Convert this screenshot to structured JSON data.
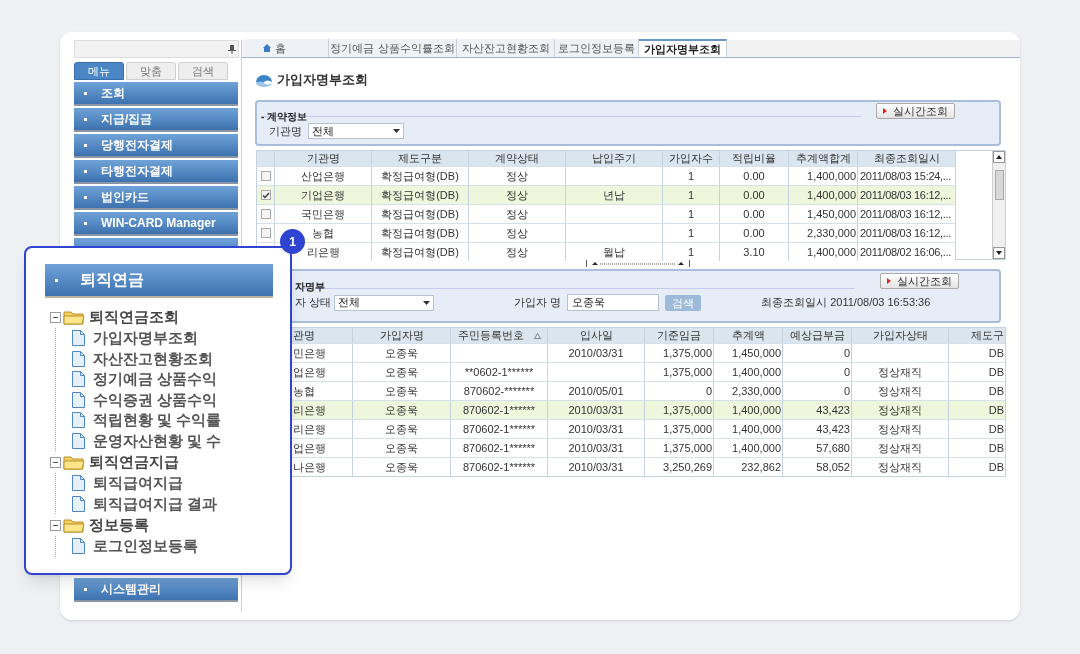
{
  "sidebar": {
    "tabs": [
      {
        "label": "메뉴",
        "selected": true
      },
      {
        "label": "맞춤",
        "selected": false
      },
      {
        "label": "검색",
        "selected": false
      }
    ],
    "items": [
      {
        "label": "조회"
      },
      {
        "label": "지급/집금"
      },
      {
        "label": "당행전자결제"
      },
      {
        "label": "타행전자결제"
      },
      {
        "label": "법인카드"
      },
      {
        "label": "WIN-CARD Manager"
      }
    ],
    "footer_item": {
      "label": "시스템관리"
    }
  },
  "tabs": [
    {
      "label": "홈",
      "kind": "home",
      "selected": false
    },
    {
      "label": "정기예금 상품수익률조회",
      "kind": "page",
      "selected": false
    },
    {
      "label": "자산잔고현황조회",
      "kind": "page",
      "selected": false
    },
    {
      "label": "로그인정보등록",
      "kind": "page",
      "selected": false
    },
    {
      "label": "가입자명부조회",
      "kind": "page",
      "selected": true
    }
  ],
  "page_title": "가입자명부조회",
  "contract_panel": {
    "title": "- 계약정보",
    "button": "실시간조회",
    "filter_label": "기관명",
    "filter_value": "전체"
  },
  "contract_table": {
    "columns": [
      "기관명",
      "제도구분",
      "계약상태",
      "납입주기",
      "가입자수",
      "적립비율",
      "추계액합계",
      "최종조회일시"
    ],
    "rows": [
      {
        "checked": false,
        "selected": false,
        "cells": [
          "산업은행",
          "확정급여형(DB)",
          "정상",
          "",
          "1",
          "0.00",
          "1,400,000",
          "2011/08/03 15:24,..."
        ]
      },
      {
        "checked": true,
        "selected": true,
        "cells": [
          "기업은행",
          "확정급여형(DB)",
          "정상",
          "년납",
          "1",
          "0.00",
          "1,400,000",
          "2011/08/03 16:12,..."
        ]
      },
      {
        "checked": false,
        "selected": false,
        "cells": [
          "국민은행",
          "확정급여형(DB)",
          "정상",
          "",
          "1",
          "0.00",
          "1,450,000",
          "2011/08/03 16:12,..."
        ]
      },
      {
        "checked": false,
        "selected": false,
        "cells": [
          "농협",
          "확정급여형(DB)",
          "정상",
          "",
          "1",
          "0.00",
          "2,330,000",
          "2011/08/03 16:12,..."
        ]
      },
      {
        "selected": false,
        "cells": [
          "리은행",
          "확정급여형(DB)",
          "정상",
          "월납",
          "1",
          "3.10",
          "1,400,000",
          "2011/08/02 16:06,..."
        ]
      }
    ]
  },
  "member_panel": {
    "title": "자명부",
    "button": "실시간조회",
    "status_label": "자 상태",
    "status_value": "전체",
    "name_label": "가입자 명",
    "name_value": "오종욱",
    "search_button": "검색",
    "last_query": "최종조회일시 2011/08/03 16:53:36"
  },
  "member_table": {
    "columns": [
      "관명",
      "가입자명",
      "주민등록번호",
      "입사일",
      "기준임금",
      "추계액",
      "예상급부금",
      "가입자상태",
      "제도구"
    ],
    "rows": [
      {
        "selected": false,
        "cells": [
          "민은행",
          "오종욱",
          "",
          "2010/03/31",
          "1,375,000",
          "1,450,000",
          "0",
          "",
          "DB"
        ]
      },
      {
        "selected": false,
        "cells": [
          "업은행",
          "오종욱",
          "**0602-1******",
          "",
          "1,375,000",
          "1,400,000",
          "0",
          "정상재직",
          "DB"
        ]
      },
      {
        "selected": false,
        "cells": [
          "농협",
          "오종욱",
          "870602-*******",
          "2010/05/01",
          "0",
          "2,330,000",
          "0",
          "정상재직",
          "DB"
        ]
      },
      {
        "selected": true,
        "cells": [
          "리은행",
          "오종욱",
          "870602-1******",
          "2010/03/31",
          "1,375,000",
          "1,400,000",
          "43,423",
          "정상재직",
          "DB"
        ]
      },
      {
        "selected": false,
        "cells": [
          "리은행",
          "오종욱",
          "870602-1******",
          "2010/03/31",
          "1,375,000",
          "1,400,000",
          "43,423",
          "정상재직",
          "DB"
        ]
      },
      {
        "selected": false,
        "cells": [
          "업은행",
          "오종욱",
          "870602-1******",
          "2010/03/31",
          "1,375,000",
          "1,400,000",
          "57,680",
          "정상재직",
          "DB"
        ]
      },
      {
        "selected": false,
        "cells": [
          "나은행",
          "오종욱",
          "870602-1******",
          "2010/03/31",
          "3,250,269",
          "232,862",
          "58,052",
          "정상재직",
          "DB"
        ]
      }
    ]
  },
  "callout": {
    "badge": "1",
    "header": "퇴직연금",
    "tree": [
      {
        "label": "퇴직연금조회",
        "expanded": true,
        "children": [
          {
            "label": "가입자명부조회"
          },
          {
            "label": "자산잔고현황조회"
          },
          {
            "label": "정기예금 상품수익"
          },
          {
            "label": "수익증권 상품수익"
          },
          {
            "label": "적립현황 및 수익률"
          },
          {
            "label": "운영자산현황 및 수"
          }
        ]
      },
      {
        "label": "퇴직연금지급",
        "expanded": true,
        "children": [
          {
            "label": "퇴직급여지급"
          },
          {
            "label": "퇴직급여지급 결과"
          }
        ]
      },
      {
        "label": "정보등록",
        "expanded": true,
        "children": [
          {
            "label": "로그인정보등록"
          }
        ]
      }
    ]
  }
}
